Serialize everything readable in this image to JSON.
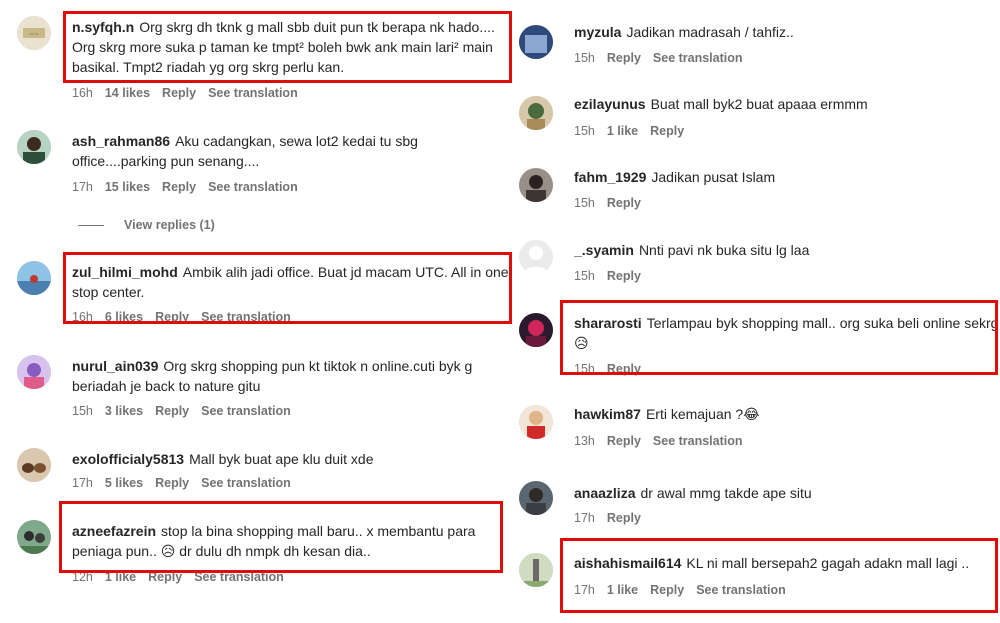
{
  "left": [
    {
      "user": "n.syfqh.n",
      "text": "Org skrg dh tknk g mall sbb duit pun tk berapa nk hado.... Org skrg more suka p taman ke tmpt² boleh bwk ank main lari² main basikal. Tmpt2 riadah yg org skrg perlu kan.",
      "time": "16h",
      "likes": "14 likes",
      "reply": "Reply",
      "translate": "See translation"
    },
    {
      "user": "ash_rahman86",
      "text": "Aku cadangkan, sewa lot2 kedai tu sbg office....parking pun senang....",
      "time": "17h",
      "likes": "15 likes",
      "reply": "Reply",
      "translate": "See translation",
      "view_replies": "View replies (1)"
    },
    {
      "user": "zul_hilmi_mohd",
      "text": "Ambik alih jadi office. Buat jd macam UTC. All in one stop center.",
      "time": "16h",
      "likes": "6 likes",
      "reply": "Reply",
      "translate": "See translation"
    },
    {
      "user": "nurul_ain039",
      "text": "Org skrg shopping pun kt tiktok n online.cuti byk g beriadah je back to nature gitu",
      "time": "15h",
      "likes": "3 likes",
      "reply": "Reply",
      "translate": "See translation"
    },
    {
      "user": "exolofficialy5813",
      "text": "Mall byk buat ape klu duit xde",
      "time": "17h",
      "likes": "5 likes",
      "reply": "Reply",
      "translate": "See translation"
    },
    {
      "user": "azneefazrein",
      "text": "stop la bina shopping mall baru.. x membantu para peniaga pun..",
      "emoji": "😥",
      "text_after": "dr dulu dh nmpk dh kesan dia..",
      "time": "12h",
      "likes": "1 like",
      "reply": "Reply",
      "translate": "See translation"
    }
  ],
  "right": [
    {
      "user": "myzula",
      "text": "Jadikan madrasah / tahfiz..",
      "time": "15h",
      "reply": "Reply",
      "translate": "See translation"
    },
    {
      "user": "ezilayunus",
      "text": "Buat mall byk2 buat apaaa ermmm",
      "time": "15h",
      "likes": "1 like",
      "reply": "Reply"
    },
    {
      "user": "fahm_1929",
      "text": "Jadikan pusat Islam",
      "time": "15h",
      "reply": "Reply"
    },
    {
      "user": "_.syamin",
      "text": "Nnti pavi nk buka situ lg laa",
      "time": "15h",
      "reply": "Reply"
    },
    {
      "user": "shararosti",
      "text": "Terlampau byk shopping mall.. org suka beli online sekrg",
      "emoji": "😥",
      "time": "15h",
      "reply": "Reply"
    },
    {
      "user": "hawkim87",
      "text": "Erti kemajuan ?",
      "emoji": "😂",
      "time": "13h",
      "reply": "Reply",
      "translate": "See translation"
    },
    {
      "user": "anaazliza",
      "text": "dr awal mmg takde ape situ",
      "time": "17h",
      "reply": "Reply"
    },
    {
      "user": "aishahismail614",
      "text": "KL ni mall bersepah2 gagah adakn mall lagi ..",
      "time": "17h",
      "likes": "1 like",
      "reply": "Reply",
      "translate": "See translation"
    }
  ],
  "colors": {
    "highlight": "#e00b0b",
    "meta": "#737373",
    "text": "#262626"
  }
}
